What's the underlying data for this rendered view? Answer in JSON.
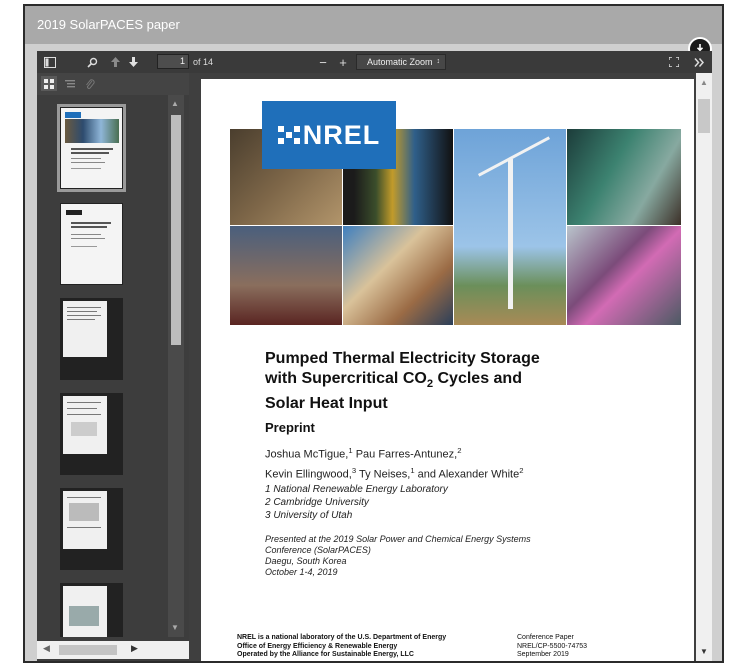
{
  "window": {
    "title": "2019 SolarPACES paper"
  },
  "toolbar": {
    "page_number": "1",
    "page_total": "of 14",
    "zoom": "Automatic Zoom",
    "zoom_out": "−",
    "zoom_in": "+"
  },
  "document": {
    "logo": "NREL",
    "title_line1": "Pumped Thermal Electricity Storage",
    "title_line2a": "with Supercritical CO",
    "title_line2sub": "2",
    "title_line2b": " Cycles and",
    "title_line3": "Solar Heat Input",
    "preprint": "Preprint",
    "author_line1": "Joshua McTigue,",
    "author_sup1": "1",
    "author_line1b": " Pau Farres-Antunez,",
    "author_sup2": "2",
    "author_line2a": "Kevin Ellingwood,",
    "author_sup3": "3",
    "author_line2b": " Ty Neises,",
    "author_sup4": "1",
    "author_line2c": " and Alexander White",
    "author_sup5": "2",
    "affiliations": [
      "1 National Renewable Energy Laboratory",
      "2 Cambridge University",
      "3 University of Utah"
    ],
    "presented": [
      "Presented at the 2019 Solar Power and Chemical Energy Systems",
      "Conference (SolarPACES)",
      "Daegu, South Korea",
      "October 1-4, 2019"
    ],
    "footer_left": [
      "NREL is a national laboratory of the U.S. Department of Energy",
      "Office of Energy Efficiency & Renewable Energy",
      "Operated by the Alliance for Sustainable Energy, LLC"
    ],
    "footer_right": [
      "Conference Paper",
      "NREL/CP-5500-74753",
      "September 2019"
    ]
  },
  "icons": [
    "sidebar-toggle-icon",
    "search-icon",
    "prev-page-icon",
    "next-page-icon",
    "fullscreen-icon",
    "more-tools-icon",
    "download-icon",
    "thumbnail-view-icon",
    "outline-view-icon",
    "attachments-icon"
  ]
}
